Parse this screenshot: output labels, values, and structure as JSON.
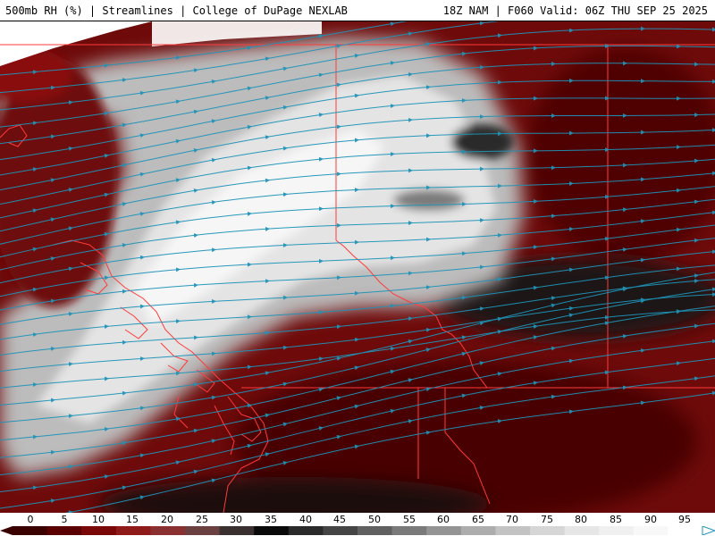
{
  "header": {
    "left_title": "500mb RH (%) | Streamlines | College of DuPage NEXLAB",
    "right_title": "18Z NAM | F060 Valid: 06Z THU SEP 25 2025"
  },
  "legend": {
    "ticks": [
      "0",
      "5",
      "10",
      "15",
      "20",
      "25",
      "30",
      "35",
      "40",
      "45",
      "50",
      "55",
      "60",
      "65",
      "70",
      "75",
      "80",
      "85",
      "90",
      "95"
    ],
    "colors": [
      "#3b0000",
      "#5a0000",
      "#7a0808",
      "#8e1a1a",
      "#8a3030",
      "#6a4040",
      "#3a3030",
      "#0a0a0a",
      "#2a2a2a",
      "#454545",
      "#606060",
      "#7a7a7a",
      "#949494",
      "#adadad",
      "#c3c3c3",
      "#d6d6d6",
      "#e6e6e6",
      "#f0f0f0",
      "#f8f8f8",
      "#ffffff"
    ]
  },
  "map": {
    "colors": {
      "dry": "#6e0a0a",
      "very_dry": "#4a0404",
      "moist": "#e8e8e8",
      "dark_band": "#141414",
      "streamline": "#1f93b8",
      "border": "#ff3b3b"
    }
  }
}
